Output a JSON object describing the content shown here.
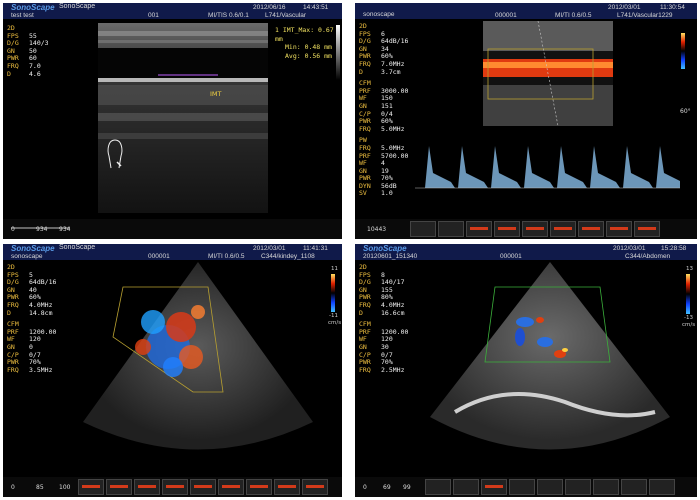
{
  "panels": [
    {
      "brand": "SonoScape",
      "brand2": "SonoScape",
      "patient": "test test",
      "id": "001",
      "mi": "MI/TIS 0.6/0.1",
      "date": "2012/06/16",
      "time": "14:43:51",
      "probe": "L741/Vascular",
      "mode": "2D",
      "params": [
        [
          "FPS",
          "55"
        ],
        [
          "D/G",
          "140/3"
        ],
        [
          "GN",
          "50"
        ],
        [
          "PWR",
          "60"
        ],
        [
          "FRQ",
          "7.0"
        ],
        [
          "D",
          "4.6"
        ]
      ],
      "measure": {
        "line1": "1  IMT_Max: 0.67   mm",
        "line2": "Min: 0.48   mm",
        "line3": "Avg: 0.56   mm"
      },
      "imt_label": "IMT",
      "bottom": [
        "0",
        "934",
        "934"
      ]
    },
    {
      "patient": "sonoscape",
      "id": "000001",
      "mi": "MI/TI 0.6/0.5",
      "date": "2012/03/01",
      "time": "11:30:54",
      "probe": "L741/Vascular1229",
      "mode": "2D",
      "params": [
        [
          "FPS",
          "6"
        ],
        [
          "D/G",
          "64dB/16"
        ],
        [
          "GN",
          "34"
        ],
        [
          "PWR",
          "60%"
        ],
        [
          "FRQ",
          "7.0MHz"
        ],
        [
          "D",
          "3.7cm"
        ]
      ],
      "cfm_label": "CFM",
      "cfm": [
        [
          "PRF",
          "3000.00"
        ],
        [
          "WF",
          "150"
        ],
        [
          "GN",
          "151"
        ],
        [
          "C/P",
          "0/4"
        ],
        [
          "PWR",
          "60%"
        ],
        [
          "FRQ",
          "5.0MHz"
        ]
      ],
      "pw_label": "PW",
      "pw": [
        [
          "FRQ",
          "5.0MHz"
        ],
        [
          "PRF",
          "5700.00"
        ],
        [
          "WF",
          "4"
        ],
        [
          "GN",
          "19"
        ],
        [
          "PWR",
          "70%"
        ],
        [
          "DYN",
          "56dB"
        ],
        [
          "SV",
          "1.0"
        ]
      ],
      "angle": "60°",
      "bottom": [
        "10443"
      ]
    },
    {
      "brand": "SonoScape",
      "brand2": "SonoScape",
      "patient": "sonoscape",
      "id": "000001",
      "mi": "MI/TI 0.6/0.5",
      "date": "2012/03/01",
      "time": "11:41:31",
      "probe": "C344/kindey_1108",
      "mode": "2D",
      "params": [
        [
          "FPS",
          "5"
        ],
        [
          "D/G",
          "64dB/16"
        ],
        [
          "GN",
          "40"
        ],
        [
          "PWR",
          "60%"
        ],
        [
          "FRQ",
          "4.0MHz"
        ],
        [
          "D",
          "14.8cm"
        ]
      ],
      "cfm_label": "CFM",
      "cfm": [
        [
          "PRF",
          "1200.00"
        ],
        [
          "WF",
          "120"
        ],
        [
          "GN",
          "0"
        ],
        [
          "C/P",
          "0/7"
        ],
        [
          "PWR",
          "70%"
        ],
        [
          "FRQ",
          "3.5MHz"
        ]
      ],
      "scale_top": "11",
      "scale_bot": "-11",
      "unit": "cm/s",
      "bottom": [
        "0",
        "85",
        "100"
      ]
    },
    {
      "brand": "SonoScape",
      "patient": "20120601_151340",
      "id": "000001",
      "mi": "",
      "date": "2012/03/01",
      "time": "15:28:58",
      "probe": "C344/Abdomen",
      "mode": "2D",
      "params": [
        [
          "FPS",
          "8"
        ],
        [
          "D/G",
          "140/17"
        ],
        [
          "GN",
          "155"
        ],
        [
          "PWR",
          "80%"
        ],
        [
          "FRQ",
          "4.0MHz"
        ],
        [
          "D",
          "16.6cm"
        ]
      ],
      "cfm_label": "CFM",
      "cfm": [
        [
          "PRF",
          "1200.00"
        ],
        [
          "WF",
          "120"
        ],
        [
          "GN",
          "30"
        ],
        [
          "C/P",
          "0/7"
        ],
        [
          "PWR",
          "70%"
        ],
        [
          "FRQ",
          "2.5MHz"
        ]
      ],
      "scale_top": "13",
      "scale_bot": "-13",
      "unit": "cm/s",
      "bottom": [
        "0",
        "69",
        "99"
      ]
    }
  ]
}
